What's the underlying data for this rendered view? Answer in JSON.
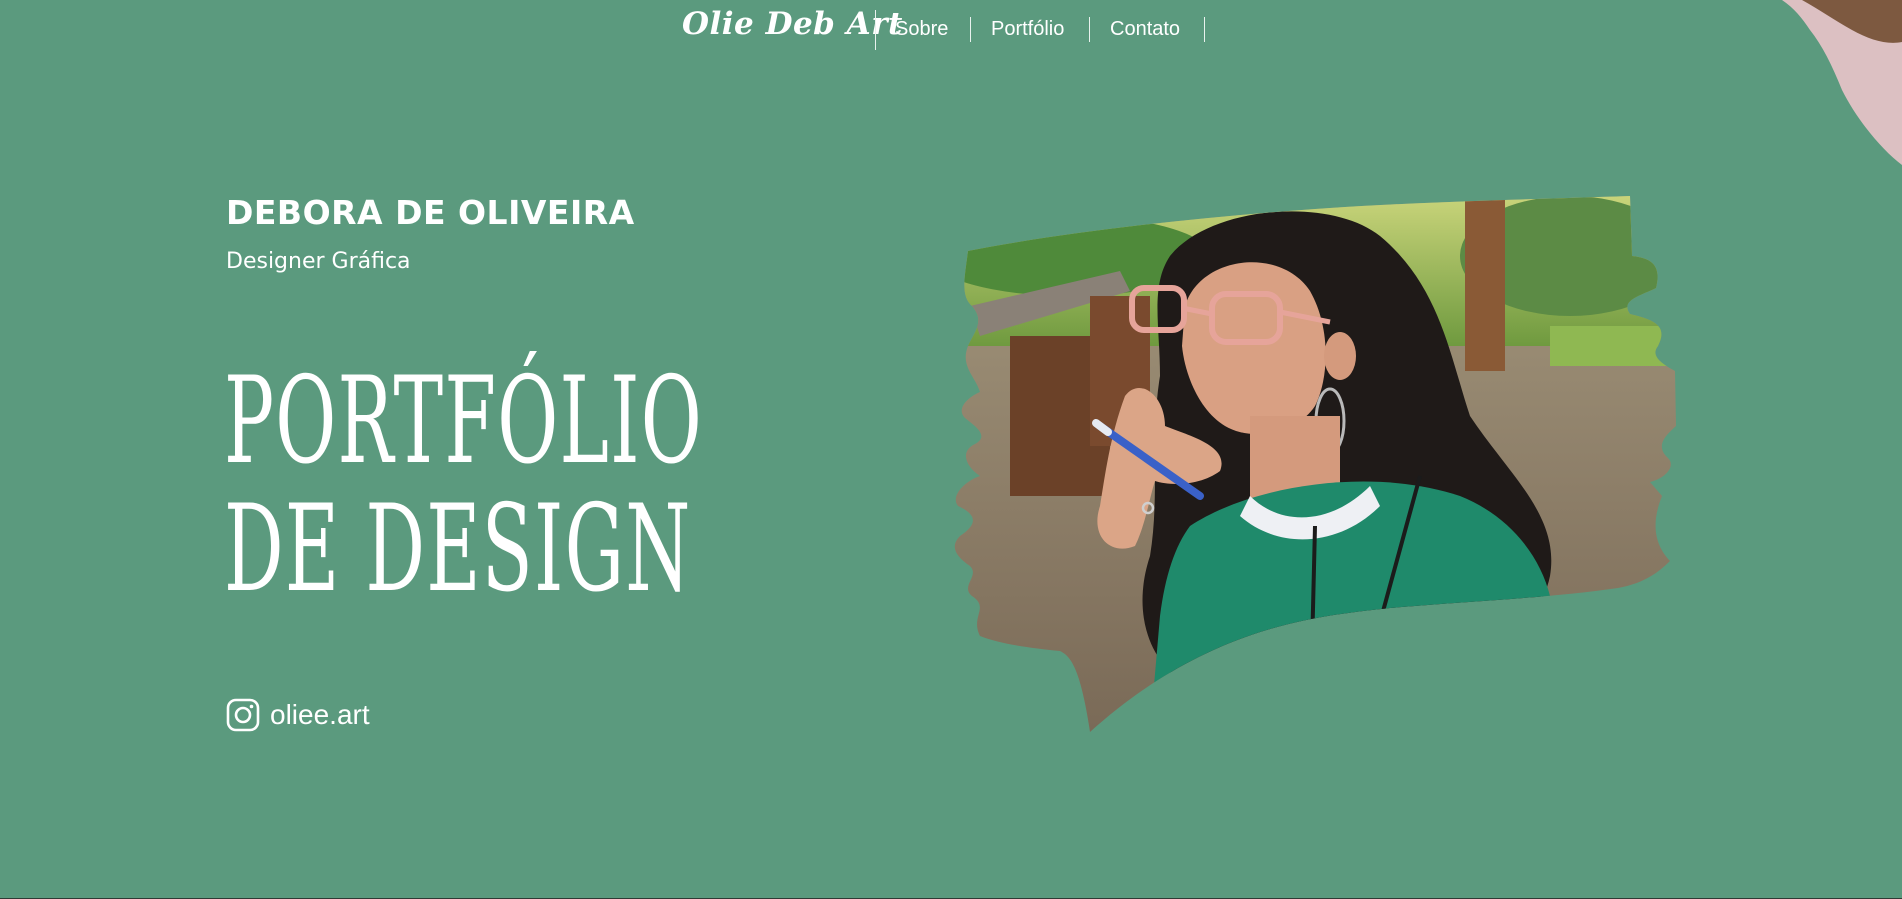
{
  "nav": {
    "brand": "Olie Deb Art",
    "links": [
      {
        "label": "Sobre"
      },
      {
        "label": "Portfólio"
      },
      {
        "label": "Contato"
      }
    ]
  },
  "hero": {
    "name": "DEBORA DE OLIVEIRA",
    "role": "Designer Gráfica",
    "title_line1": "PORTFÓLIO",
    "title_line2": "DE DESIGN",
    "social": {
      "icon": "instagram-icon",
      "handle": "oliee.art"
    }
  },
  "photo": {
    "description_icon": "portrait-photo"
  },
  "colors": {
    "background": "#5b9a7e",
    "text": "#ffffff",
    "blob_pink": "#dcc0c2",
    "blob_brown": "#7d5940",
    "shirt_green": "#1f8a6b"
  }
}
